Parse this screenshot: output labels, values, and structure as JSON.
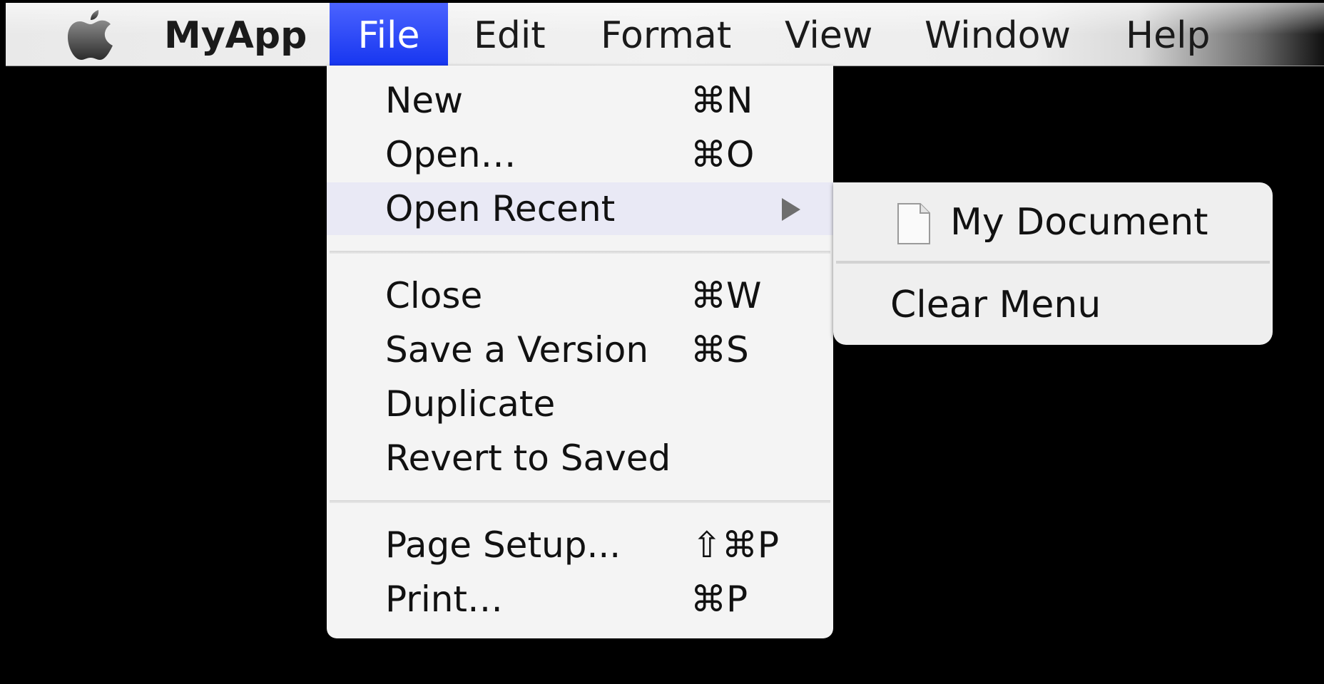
{
  "menubar": {
    "app_name": "MyApp",
    "menus": [
      "File",
      "Edit",
      "Format",
      "View",
      "Window",
      "Help"
    ],
    "active_menu": "File"
  },
  "file_menu": {
    "items": [
      {
        "label": "New",
        "shortcut": "⌘N"
      },
      {
        "label": "Open…",
        "shortcut": "⌘O"
      },
      {
        "label": "Open Recent",
        "has_submenu": true
      },
      {
        "label": "Close",
        "shortcut": "⌘W"
      },
      {
        "label": "Save a Version",
        "shortcut": "⌘S"
      },
      {
        "label": "Duplicate",
        "shortcut": ""
      },
      {
        "label": "Revert to Saved",
        "shortcut": ""
      },
      {
        "label": "Page Setup...",
        "shortcut": "⇧⌘P"
      },
      {
        "label": "Print…",
        "shortcut": "⌘P"
      }
    ]
  },
  "open_recent_submenu": {
    "items": [
      {
        "label": "My Document",
        "icon": "document-icon"
      },
      {
        "label": "Clear Menu"
      }
    ]
  },
  "colors": {
    "active_menu_bg": "#1f3ef4",
    "menu_bg": "#f4f4f4",
    "highlight_bg": "#e9e9f5",
    "desktop_bg": "#000000"
  }
}
